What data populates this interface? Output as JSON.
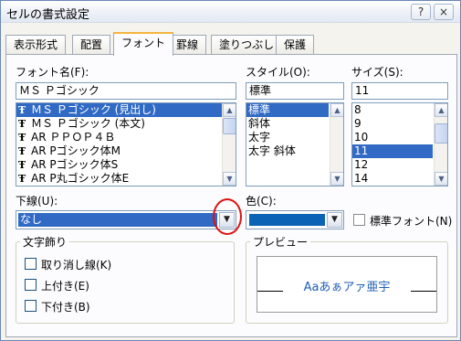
{
  "window": {
    "title": "セルの書式設定",
    "help_button": "?",
    "close_button": "×"
  },
  "tabs": [
    "表示形式",
    "配置",
    "フォント",
    "罫線",
    "塗りつぶし",
    "保護"
  ],
  "active_tab": "フォント",
  "font_name": {
    "label": "フォント名(F):",
    "value": "ＭＳ Ｐゴシック",
    "options": [
      "ＭＳ Ｐゴシック (見出し)",
      "ＭＳ Ｐゴシック (本文)",
      "AR ＰＰＯＰ４Ｂ",
      "AR Pゴシック体M",
      "AR Pゴシック体S",
      "AR P丸ゴシック体E"
    ],
    "selected_index": 0
  },
  "style": {
    "label": "スタイル(O):",
    "value": "標準",
    "options": [
      "標準",
      "斜体",
      "太字",
      "太字 斜体"
    ],
    "selected_index": 0
  },
  "size": {
    "label": "サイズ(S):",
    "value": "11",
    "options": [
      "8",
      "9",
      "10",
      "11",
      "12",
      "14"
    ],
    "selected_index": 3
  },
  "underline": {
    "label": "下線(U):",
    "value": "なし"
  },
  "color": {
    "label": "色(C):",
    "swatch": "#0a63b5",
    "normal_font_label": "標準フォント(N)"
  },
  "effects": {
    "title": "文字飾り",
    "items": [
      "取り消し線(K)",
      "上付き(E)",
      "下付き(B)"
    ]
  },
  "preview": {
    "title": "プレビュー",
    "sample": "Aaあぁアァ亜宇",
    "sample_color": "#1f5fb4"
  },
  "colors": {
    "selection": "#316ac5",
    "highlight_circle": "#e01010"
  }
}
